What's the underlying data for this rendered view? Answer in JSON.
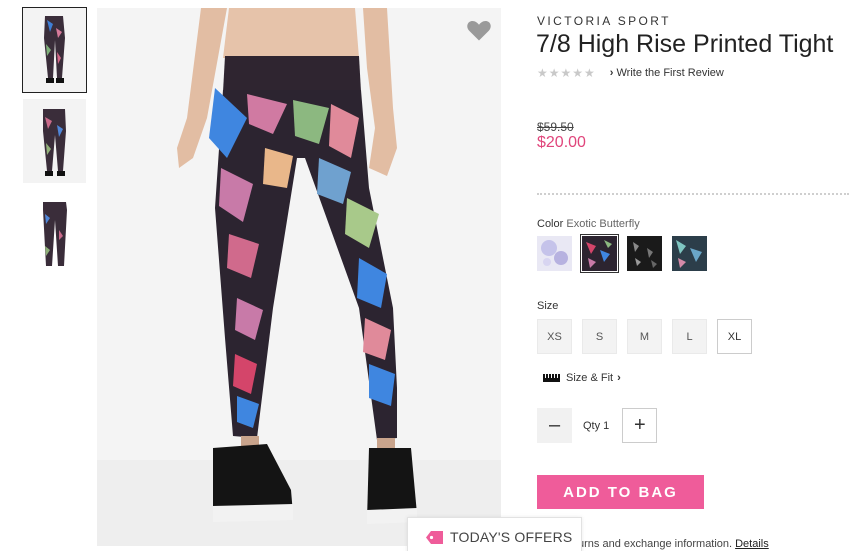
{
  "product": {
    "brand": "VICTORIA SPORT",
    "title": "7/8 High Rise Printed Tight",
    "stars": "★★★★★",
    "review_link": "Write the First Review",
    "old_price": "$59.50",
    "price": "$20.00"
  },
  "color": {
    "label": "Color",
    "value": "Exotic Butterfly",
    "swatches": [
      "tie-dye",
      "exotic-butterfly",
      "black-print",
      "teal-butterfly"
    ],
    "selected_index": 1
  },
  "size": {
    "label": "Size",
    "options": [
      "XS",
      "S",
      "M",
      "L",
      "XL"
    ],
    "available": [
      "XL"
    ]
  },
  "size_fit": {
    "label": "Size & Fit",
    "chevron": "›"
  },
  "quantity": {
    "minus": "–",
    "label": "Qty 1",
    "plus": "+"
  },
  "add_to_bag": "ADD TO BAG",
  "returns": {
    "text": "urns and exchange information.",
    "link": "Details"
  },
  "offers": {
    "label": "TODAY'S OFFERS"
  },
  "colors": {
    "accent_pink": "#ef5c9a",
    "price_pink": "#e0457b"
  },
  "icons": {
    "favorite": "heart-icon",
    "offers": "tag-icon",
    "size_fit": "ruler-icon"
  }
}
